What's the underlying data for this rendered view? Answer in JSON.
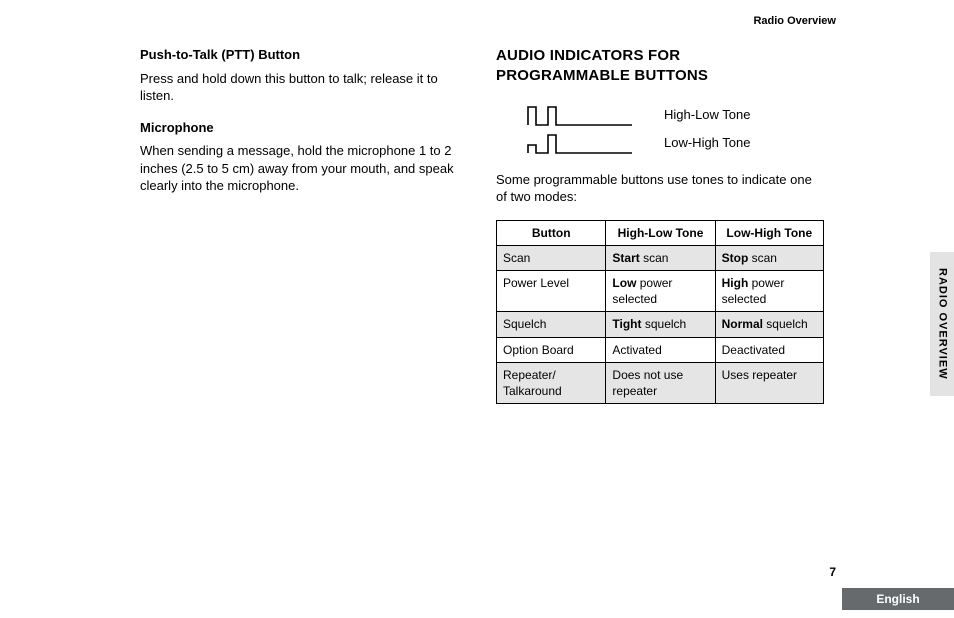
{
  "runningHead": "Radio Overview",
  "leftCol": {
    "h1": "Push-to-Talk (PTT) Button",
    "p1": "Press and hold down this button to talk; release it to listen.",
    "h2": "Microphone",
    "p2": "When sending a message, hold the microphone 1 to 2 inches (2.5 to 5 cm) away from your mouth, and speak clearly into the microphone."
  },
  "rightCol": {
    "title": "AUDIO INDICATORS FOR PROGRAMMABLE BUTTONS",
    "tone1Label": "High-Low Tone",
    "tone2Label": "Low-High Tone",
    "intro": "Some programmable buttons use tones to indicate one of two modes:"
  },
  "table": {
    "headers": [
      "Button",
      "High-Low Tone",
      "Low-High Tone"
    ],
    "rows": [
      {
        "shade": true,
        "cells": [
          [
            {
              "t": "Scan"
            }
          ],
          [
            {
              "t": "Start",
              "b": true
            },
            {
              "t": " scan"
            }
          ],
          [
            {
              "t": "Stop",
              "b": true
            },
            {
              "t": " scan"
            }
          ]
        ]
      },
      {
        "shade": false,
        "cells": [
          [
            {
              "t": "Power Level"
            }
          ],
          [
            {
              "t": "Low",
              "b": true
            },
            {
              "t": " power selected"
            }
          ],
          [
            {
              "t": "High",
              "b": true
            },
            {
              "t": " power selected"
            }
          ]
        ]
      },
      {
        "shade": true,
        "cells": [
          [
            {
              "t": "Squelch"
            }
          ],
          [
            {
              "t": "Tight",
              "b": true
            },
            {
              "t": " squelch"
            }
          ],
          [
            {
              "t": "Normal",
              "b": true
            },
            {
              "t": " squelch"
            }
          ]
        ]
      },
      {
        "shade": false,
        "cells": [
          [
            {
              "t": "Option Board"
            }
          ],
          [
            {
              "t": "Activated"
            }
          ],
          [
            {
              "t": "Deactivated"
            }
          ]
        ]
      },
      {
        "shade": true,
        "cells": [
          [
            {
              "t": "Repeater/ Talkaround"
            }
          ],
          [
            {
              "t": "Does not use repeater"
            }
          ],
          [
            {
              "t": "Uses repeater"
            }
          ]
        ]
      }
    ]
  },
  "sideTab": "RADIO OVERVIEW",
  "pageNumber": "7",
  "langTab": "English"
}
